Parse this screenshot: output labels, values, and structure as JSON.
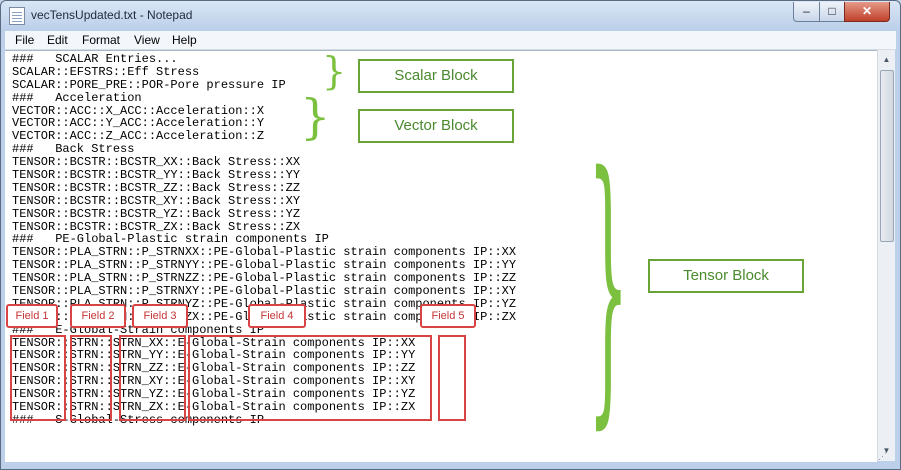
{
  "window": {
    "title": "vecTensUpdated.txt - Notepad",
    "controls": {
      "minimize": "–",
      "maximize": "□",
      "close": "✕"
    }
  },
  "menu": [
    "File",
    "Edit",
    "Format",
    "View",
    "Help"
  ],
  "lines": [
    "###   SCALAR Entries...",
    "SCALAR::EFSTRS::Eff Stress",
    "SCALAR::PORE_PRE::POR-Pore pressure IP",
    "###   Acceleration",
    "VECTOR::ACC::X_ACC::Acceleration::X",
    "VECTOR::ACC::Y_ACC::Acceleration::Y",
    "VECTOR::ACC::Z_ACC::Acceleration::Z",
    "###   Back Stress",
    "TENSOR::BCSTR::BCSTR_XX::Back Stress::XX",
    "TENSOR::BCSTR::BCSTR_YY::Back Stress::YY",
    "TENSOR::BCSTR::BCSTR_ZZ::Back Stress::ZZ",
    "TENSOR::BCSTR::BCSTR_XY::Back Stress::XY",
    "TENSOR::BCSTR::BCSTR_YZ::Back Stress::YZ",
    "TENSOR::BCSTR::BCSTR_ZX::Back Stress::ZX",
    "###   PE-Global-Plastic strain components IP",
    "TENSOR::PLA_STRN::P_STRNXX::PE-Global-Plastic strain components IP::XX",
    "TENSOR::PLA_STRN::P_STRNYY::PE-Global-Plastic strain components IP::YY",
    "TENSOR::PLA_STRN::P_STRNZZ::PE-Global-Plastic strain components IP::ZZ",
    "TENSOR::PLA_STRN::P_STRNXY::PE-Global-Plastic strain components IP::XY",
    "TENSOR::PLA_STRN::P_STRNYZ::PE-Global-Plastic strain components IP::YZ",
    "TENSOR::PLA_STRN::P_STRNZX::PE-Global-Plastic strain components IP::ZX",
    "###   E-Global-Strain components IP",
    "TENSOR::STRN::STRN_XX::E-Global-Strain components IP::XX",
    "TENSOR::STRN::STRN_YY::E-Global-Strain components IP::YY",
    "TENSOR::STRN::STRN_ZZ::E-Global-Strain components IP::ZZ",
    "TENSOR::STRN::STRN_XY::E-Global-Strain components IP::XY",
    "TENSOR::STRN::STRN_YZ::E-Global-Strain components IP::YZ",
    "TENSOR::STRN::STRN_ZX::E-Global-Strain components IP::ZX",
    "###   S-Global-Stress components IP"
  ],
  "annotations": {
    "scalar_block": "Scalar Block",
    "vector_block": "Vector Block",
    "tensor_block": "Tensor Block",
    "fields": [
      "Field 1",
      "Field 2",
      "Field 3",
      "Field 4",
      "Field 5"
    ],
    "colors": {
      "block": "#6aa338",
      "brace": "#7cc040",
      "field": "#d84444"
    }
  }
}
